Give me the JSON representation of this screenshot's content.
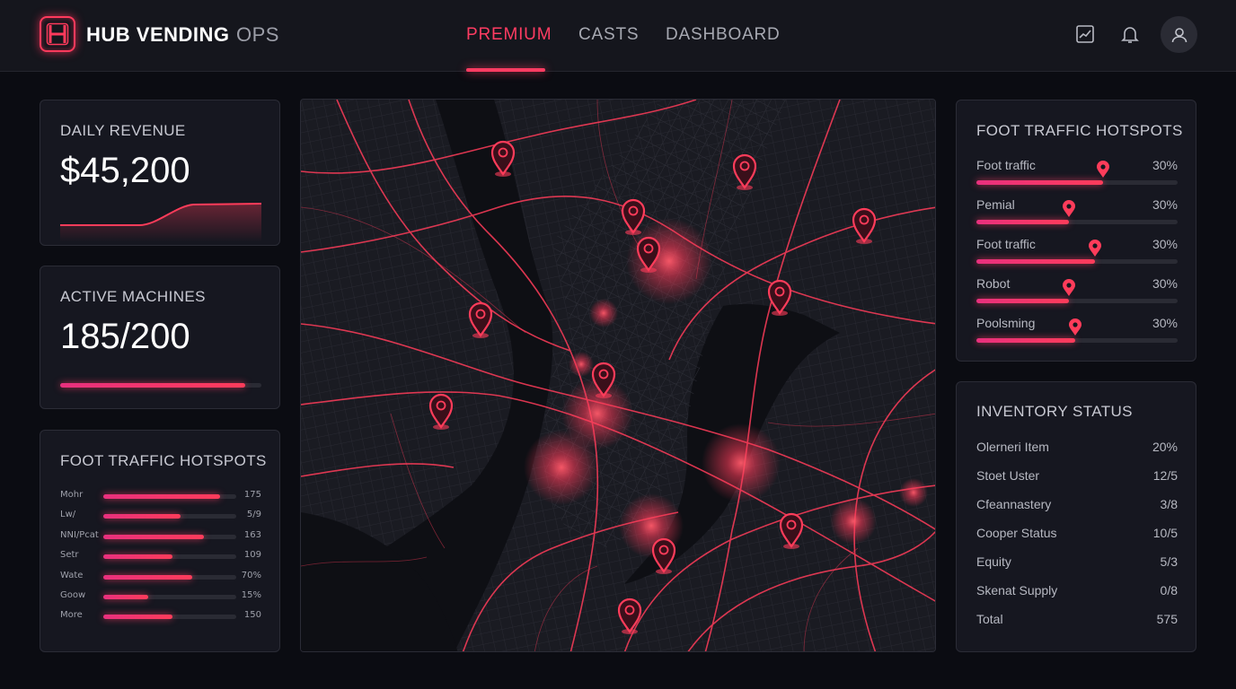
{
  "header": {
    "logo_strong": "HUB VENDING",
    "logo_light": "OPS",
    "nav": [
      {
        "label": "PREMIUM",
        "active": true
      },
      {
        "label": "CASTS",
        "active": false
      },
      {
        "label": "DASHBOARD",
        "active": false
      }
    ],
    "icons": [
      "chart-icon",
      "bell-icon",
      "user-icon"
    ]
  },
  "revenue": {
    "title": "DAILY REVENUE",
    "value": "$45,200"
  },
  "machines": {
    "title": "ACTIVE MACHINES",
    "value": "185/200",
    "progress": 0.92
  },
  "hotspots_left": {
    "title": "FOOT TRAFFIC HOTSPOTS",
    "rows": [
      {
        "label": "Mohr",
        "value": "175",
        "fill": 0.88
      },
      {
        "label": "Lw/",
        "value": "5/9",
        "fill": 0.58
      },
      {
        "label": "NNI/Pcat",
        "value": "163",
        "fill": 0.76
      },
      {
        "label": "Setr",
        "value": "109",
        "fill": 0.52
      },
      {
        "label": "Wate",
        "value": "70%",
        "fill": 0.67
      },
      {
        "label": "Goow",
        "value": "15%",
        "fill": 0.34
      },
      {
        "label": "More",
        "value": "150",
        "fill": 0.52
      }
    ]
  },
  "hotspots_right": {
    "title": "FOOT TRAFFIC HOTSPOTS",
    "rows": [
      {
        "label": "Foot traffic",
        "pct": "30%",
        "fill": 0.63
      },
      {
        "label": "Pemial",
        "pct": "30%",
        "fill": 0.46
      },
      {
        "label": "Foot traffic",
        "pct": "30%",
        "fill": 0.59
      },
      {
        "label": "Robot",
        "pct": "30%",
        "fill": 0.46
      },
      {
        "label": "Poolsming",
        "pct": "30%",
        "fill": 0.49
      }
    ]
  },
  "inventory": {
    "title": "INVENTORY STATUS",
    "rows": [
      {
        "label": "Olerneri Item",
        "value": "20%"
      },
      {
        "label": "Stoet Uster",
        "value": "12/5"
      },
      {
        "label": "Cfeannastery",
        "value": "3/8"
      },
      {
        "label": "Cooper Status",
        "value": "10/5"
      },
      {
        "label": "Equity",
        "value": "5/3"
      },
      {
        "label": "Skenat Supply",
        "value": "0/8"
      },
      {
        "label": "Total",
        "value": "575"
      }
    ]
  },
  "map": {
    "accent": "#ff3c5a",
    "markers": [
      "map-pin-icon"
    ]
  }
}
